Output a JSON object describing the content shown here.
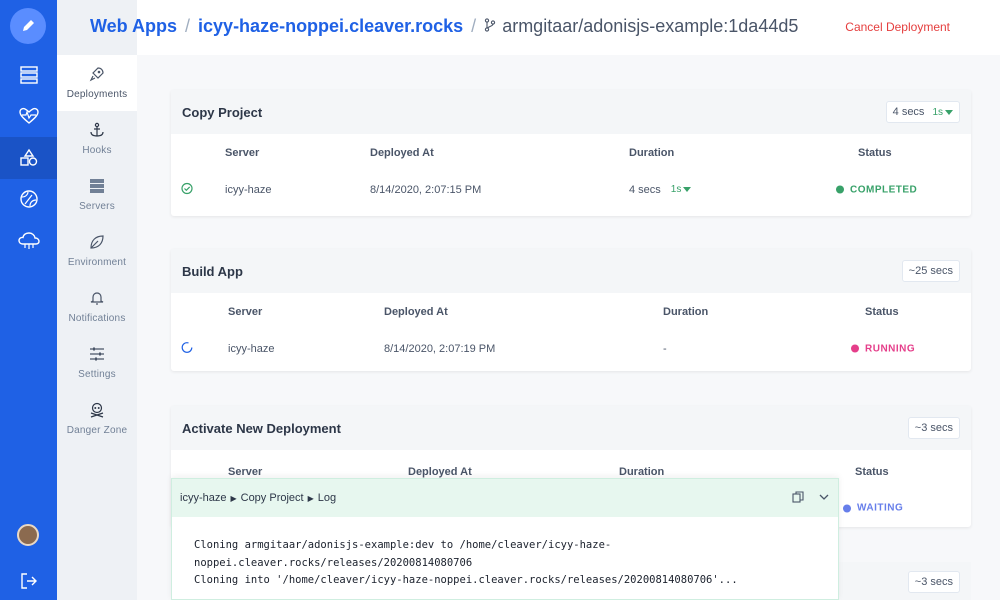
{
  "header": {
    "breadcrumb": [
      "Web Apps",
      "icyy-haze-noppei.cleaver.rocks",
      "armgitaar/adonisjs-example:1da44d5"
    ],
    "cancel_label": "Cancel Deployment"
  },
  "subnav": {
    "items": [
      {
        "label": "Deployments",
        "icon": "rocket-icon"
      },
      {
        "label": "Hooks",
        "icon": "anchor-icon"
      },
      {
        "label": "Servers",
        "icon": "server-icon"
      },
      {
        "label": "Environment",
        "icon": "leaf-icon"
      },
      {
        "label": "Notifications",
        "icon": "bell-icon"
      },
      {
        "label": "Settings",
        "icon": "sliders-icon"
      },
      {
        "label": "Danger Zone",
        "icon": "skull-icon"
      }
    ]
  },
  "columns": {
    "server": "Server",
    "deployed_at": "Deployed At",
    "duration": "Duration",
    "status": "Status"
  },
  "cards": [
    {
      "title": "Copy Project",
      "duration": "4 secs",
      "pill": "1s",
      "row": {
        "server": "icyy-haze",
        "deployed_at": "8/14/2020, 2:07:15 PM",
        "duration": "4 secs",
        "pill": "1s",
        "status": "COMPLETED"
      }
    },
    {
      "title": "Build App",
      "duration": "~25 secs",
      "row": {
        "server": "icyy-haze",
        "deployed_at": "8/14/2020, 2:07:19 PM",
        "duration": "-",
        "status": "RUNNING"
      }
    },
    {
      "title": "Activate New Deployment",
      "duration": "~3 secs",
      "row": {
        "status": "WAITING"
      }
    },
    {
      "duration": "~3 secs"
    }
  ],
  "log": {
    "breadcrumb": [
      "icyy-haze",
      "Copy Project",
      "Log"
    ],
    "lines": [
      "Cloning armgitaar/adonisjs-example:dev to /home/cleaver/icyy-haze-",
      "noppei.cleaver.rocks/releases/20200814080706",
      "Cloning into '/home/cleaver/icyy-haze-noppei.cleaver.rocks/releases/20200814080706'..."
    ]
  },
  "colors": {
    "primary": "#1f61e5",
    "completed": "#38a169",
    "running": "#e53e8a",
    "waiting": "#667eea",
    "danger": "#e53e3e"
  }
}
